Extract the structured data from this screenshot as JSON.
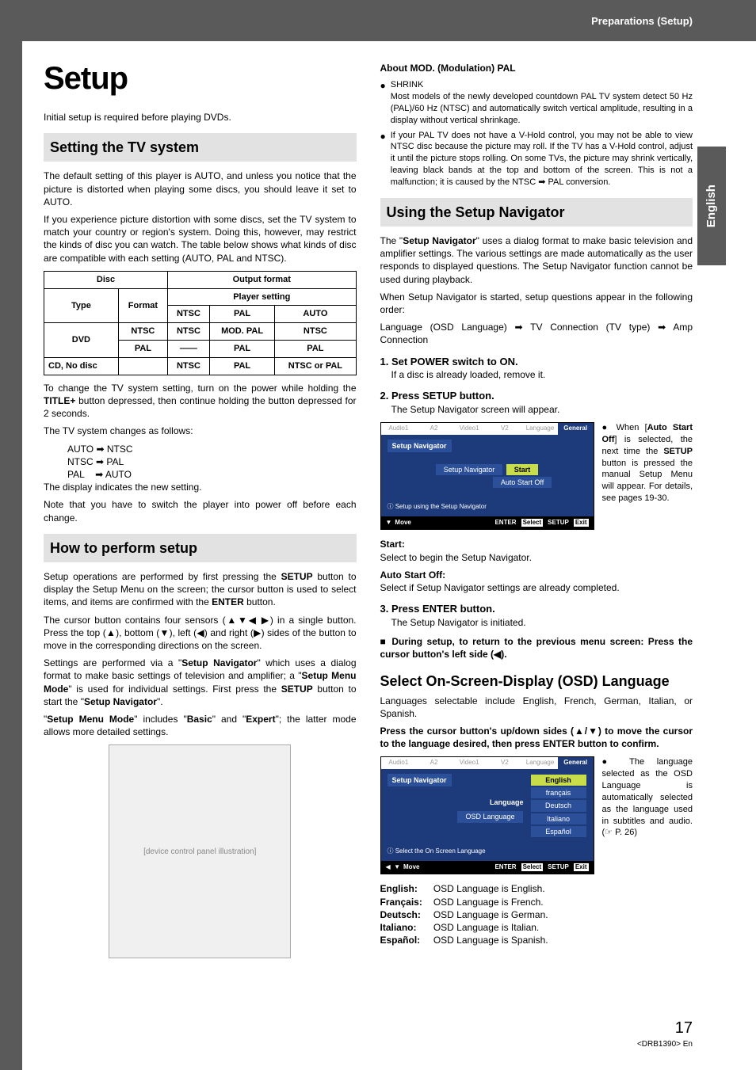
{
  "header": {
    "breadcrumb": "Preparations (Setup)"
  },
  "tab": {
    "language": "English"
  },
  "title": "Setup",
  "intro": "Initial setup is required before playing DVDs.",
  "sec_tv": {
    "heading": "Setting the TV system",
    "p1": "The default setting of this player is AUTO, and unless you notice that the picture is distorted when playing some discs, you should leave it set to AUTO.",
    "p2": "If you experience picture distortion with some discs, set the TV system to match your country or region's system. Doing this, however, may restrict the kinds of disc you can watch. The table below shows what kinds of disc are compatible with each setting (AUTO, PAL and NTSC).",
    "table": {
      "h_disc": "Disc",
      "h_output": "Output format",
      "h_player": "Player setting",
      "h_type": "Type",
      "h_format": "Format",
      "h_ntsc": "NTSC",
      "h_pal": "PAL",
      "h_auto": "AUTO",
      "r1_type": "DVD",
      "r1_fmt": "NTSC",
      "r1_a": "NTSC",
      "r1_b": "MOD. PAL",
      "r1_c": "NTSC",
      "r2_fmt": "PAL",
      "r2_a": "——",
      "r2_b": "PAL",
      "r2_c": "PAL",
      "r3_type": "CD, No disc",
      "r3_fmt": "",
      "r3_a": "NTSC",
      "r3_b": "PAL",
      "r3_c": "NTSC or PAL"
    },
    "p3a": "To change the TV system setting, turn on the power while holding the ",
    "p3b": "TITLE+",
    "p3c": " button depressed, then continue holding the button depressed for 2 seconds.",
    "p4": "The TV system changes as follows:",
    "seq1a": "AUTO",
    "seq1b": "NTSC",
    "seq2a": "NTSC",
    "seq2b": "PAL",
    "seq3a": "PAL",
    "seq3b": "AUTO",
    "p5": "The display indicates the new setting.",
    "p6": "Note that you have to switch the player into power off before each change."
  },
  "sec_how": {
    "heading": "How to perform setup",
    "p1a": "Setup operations are performed by first pressing the ",
    "p1b": "SETUP",
    "p1c": " button to display the Setup Menu on the screen; the cursor button is used to select items, and items are confirmed with the ",
    "p1d": "ENTER",
    "p1e": " button.",
    "p2": "The cursor button contains four sensors (▲▼◀ ▶) in a single button. Press the top (▲), bottom (▼), left (◀) and right (▶) sides of the button to move in the corresponding directions on the screen.",
    "p3a": "Settings are performed via a \"",
    "p3b": "Setup Navigator",
    "p3c": "\" which uses a dialog format to make basic settings of television and amplifier; a \"",
    "p3d": "Setup Menu Mode",
    "p3e": "\" is used for individual settings. First press the ",
    "p3f": "SETUP",
    "p3g": " button to start the \"",
    "p3h": "Setup Navigator",
    "p3i": "\".",
    "p4a": "\"",
    "p4b": "Setup Menu Mode",
    "p4c": "\" includes \"",
    "p4d": "Basic",
    "p4e": "\" and \"",
    "p4f": "Expert",
    "p4g": "\"; the latter mode allows more detailed settings."
  },
  "device_placeholder": "[device control panel illustration]",
  "sec_mod": {
    "heading": "About MOD. (Modulation) PAL",
    "b1_label": "SHRINK",
    "b1": "Most models of the newly developed countdown PAL TV system detect 50 Hz (PAL)/60 Hz (NTSC) and automatically switch vertical amplitude, resulting in a display without vertical shrinkage.",
    "b2": "If your PAL TV does not have a V-Hold control, you may not be able to view NTSC disc because the picture may roll. If the TV has a V-Hold control, adjust it until the picture stops rolling. On some TVs, the picture may shrink vertically, leaving black bands at the top and bottom of the screen. This is not a malfunction; it is caused by the NTSC ➡ PAL conversion."
  },
  "sec_nav": {
    "heading": "Using the Setup Navigator",
    "p1a": "The \"",
    "p1b": "Setup Navigator",
    "p1c": "\" uses a dialog format to make basic television and amplifier settings. The various settings are made automatically as the user responds to displayed questions. The Setup Navigator function cannot be used during playback.",
    "p2": "When Setup Navigator is started, setup questions appear in the following order:",
    "p3": "Language (OSD Language) ➡ TV Connection (TV type) ➡ Amp Connection",
    "s1": "1. Set POWER switch to ON.",
    "s1a": "If a disc is already loaded, remove it.",
    "s2": "2. Press SETUP button.",
    "s2a": "The Setup Navigator screen will appear.",
    "menu1_tabs": {
      "a": "Audio1",
      "b": "A2",
      "c": "Video1",
      "d": "V2",
      "e": "Language",
      "f": "General"
    },
    "menu1_label": "Setup Navigator",
    "menu1_sub": "Setup Navigator",
    "menu1_o1": "Start",
    "menu1_o2": "Auto Start Off",
    "menu1_info": "ⓘ Setup using the Setup Navigator",
    "menu1_foot": {
      "move": "Move",
      "enter": "ENTER",
      "select": "Select",
      "setup": "SETUP",
      "exit": "Exit"
    },
    "note1a": "When [",
    "note1b": "Auto Start Off",
    "note1c": "] is selected, the next time the ",
    "note1d": "SETUP",
    "note1e": " button is pressed the manual Setup Menu will appear. For details, see pages 19-30.",
    "start_h": "Start:",
    "start_t": "Select to begin the Setup Navigator.",
    "aso_h": "Auto Start Off:",
    "aso_t": "Select if Setup Navigator settings are already completed.",
    "s3": "3. Press ENTER button.",
    "s3a": "The Setup Navigator is initiated.",
    "s_back": "■ During setup, to return to the previous menu screen: Press the cursor button's left side (◀)."
  },
  "sec_osd": {
    "heading": "Select On-Screen-Display (OSD) Language",
    "p1": "Languages selectable include English, French, German, Italian, or Spanish.",
    "p2": "Press the cursor button's up/down sides (▲/▼) to move the cursor to the language desired,  then press ENTER button to confirm.",
    "menu2_label": "Setup Navigator",
    "menu2_group": "Language",
    "menu2_sub": "OSD Language",
    "menu2_o1": "English",
    "menu2_o2": "français",
    "menu2_o3": "Deutsch",
    "menu2_o4": "Italiano",
    "menu2_o5": "Español",
    "menu2_info": "ⓘ Select the On Screen Language",
    "note2": "The language selected as the OSD Language is automatically selected as the language used in subtitles and audio. (☞ P. 26)",
    "langs": {
      "en_l": "English:",
      "en_t": "OSD Language is English.",
      "fr_l": "Français:",
      "fr_t": "OSD Language is French.",
      "de_l": "Deutsch:",
      "de_t": "OSD Language is German.",
      "it_l": "Italiano:",
      "it_t": "OSD Language is Italian.",
      "es_l": "Español:",
      "es_t": "OSD Language is Spanish."
    }
  },
  "footer": {
    "page": "17",
    "code": "<DRB1390> En"
  }
}
